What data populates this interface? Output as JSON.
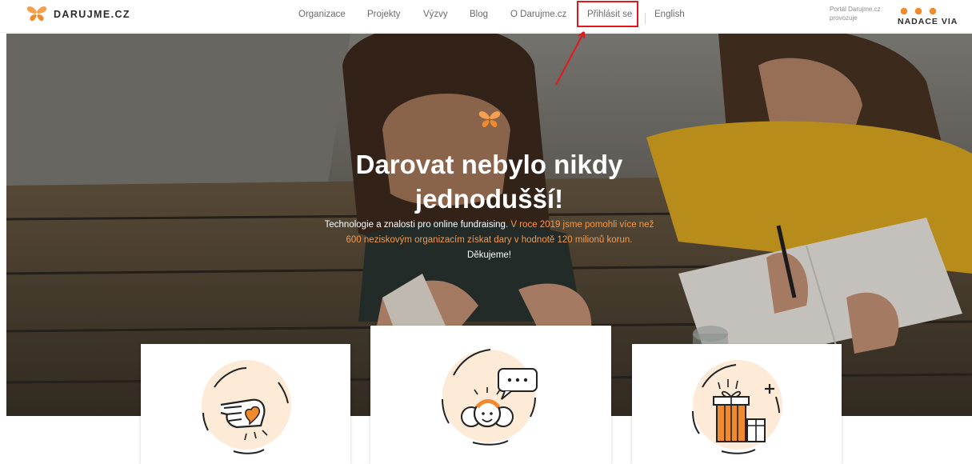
{
  "header": {
    "brand": "DARUJME.CZ",
    "nav": [
      "Organizace",
      "Projekty",
      "Výzvy",
      "Blog",
      "O Darujme.cz",
      "Přihlásit se",
      "English"
    ],
    "portal_line1": "Portál Darujme.cz",
    "portal_line2": "provozuje",
    "via_name": "NADACE VIA"
  },
  "hero": {
    "title_line1": "Darovat nebylo nikdy",
    "title_line2": "jednodušší!",
    "sub_line1_white": "Technologie a znalosti pro online fundraising.",
    "sub_line1_orange": " V roce 2019 jsme pomohli více než",
    "sub_line2_orange": "600 neziskovým organizacím získat dary v hodnotě 120 milionů korun.",
    "sub_line3": "Děkujeme!"
  },
  "colors": {
    "accent": "#f59a4b",
    "highlight_box": "#e3171c"
  },
  "cards": [
    {
      "icon": "hand-heart-icon"
    },
    {
      "icon": "people-chat-icon"
    },
    {
      "icon": "gifts-icon"
    }
  ]
}
